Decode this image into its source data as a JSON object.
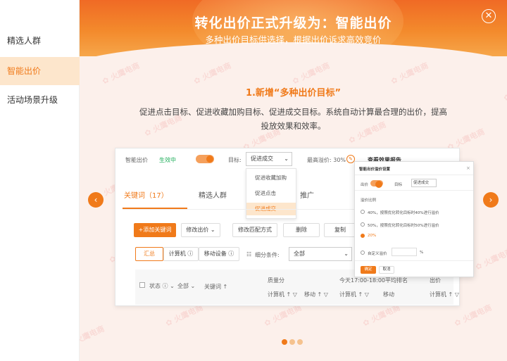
{
  "sidebar": {
    "items": [
      {
        "label": "精选人群"
      },
      {
        "label": "智能出价",
        "active": true
      },
      {
        "label": "活动场景升级"
      }
    ]
  },
  "banner": {
    "title": "转化出价正式升级为：智能出价",
    "subtitle": "多种出价目标供选择，根据出价诉求高效竞价"
  },
  "feature": {
    "title": "1.新增“多种出价目标”",
    "desc_line1": "促进点击目标、促进收藏加购目标、促进成交目标。系统自动计算最合理的出价，提高",
    "desc_line2": "投放效果和效率。"
  },
  "watermark": "火鹰电商",
  "carousel": {
    "prev": "‹",
    "next": "›",
    "close": "✕",
    "dots": 3,
    "active_dot": 0
  },
  "shot": {
    "smart_bid_label": "智能出价",
    "status": "生效中",
    "target_label": "目标:",
    "target_value": "促进成交",
    "max_premium": "最高溢价: 30%",
    "view_report": "查看效果报告",
    "dropdown": [
      "促进收藏加购",
      "促进点击",
      "促进成交"
    ],
    "tabs": [
      "关键词（17）",
      "精选人群",
      "推广"
    ],
    "toolbar": [
      "+添加关键词",
      "修改出价",
      "修改匹配方式",
      "删除",
      "复制"
    ],
    "filter_tabs": [
      "汇总",
      "计算机",
      "移动设备"
    ],
    "breakdown_label": "细分条件:",
    "breakdown_value": "全部",
    "col_quality": "质量分",
    "col_rank": "今天17:00-18:00平均排名",
    "col_bid": "出价",
    "col_status": "状态",
    "col_all": "全部",
    "col_keyword": "关键词",
    "sub_pc": "计算机",
    "sub_mobile": "移动"
  },
  "popup": {
    "title": "智能出价溢价设置",
    "toggle_label": "出价",
    "target_label": "目标",
    "target_value": "促进成交",
    "section": "溢价比例",
    "opt1": "40%，按照优化转化目标时40%进行溢价",
    "opt2": "50%，按照优化转化目标时50%进行溢价",
    "opt3": "20%",
    "opt4": "自定义溢价",
    "ok": "确定",
    "cancel": "取消"
  },
  "colors": {
    "accent": "#f07a1a",
    "active_bg": "#fde6cc",
    "bg": "#fcf0eb"
  }
}
